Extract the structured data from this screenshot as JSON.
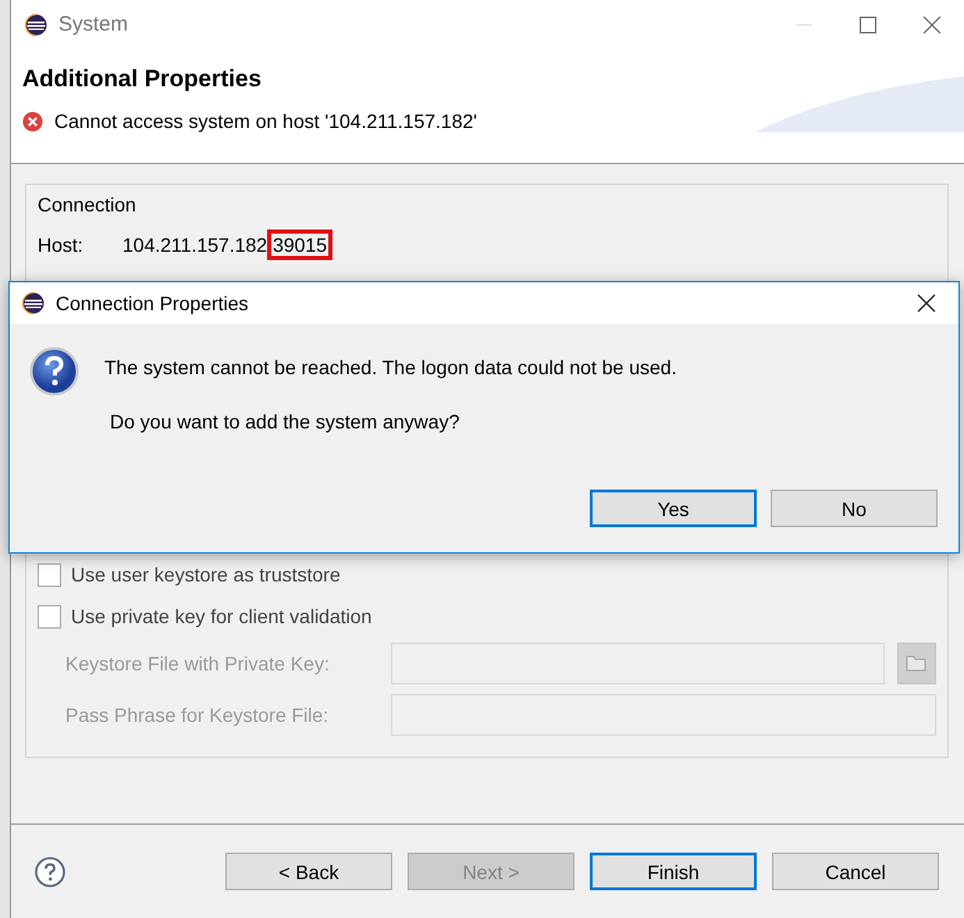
{
  "window": {
    "title": "System"
  },
  "header": {
    "title": "Additional Properties",
    "error": "Cannot access system on host '104.211.157.182'"
  },
  "group": {
    "title": "Connection",
    "host_label": "Host:",
    "host": "104.211.157.182",
    "port": "39015",
    "port_highlighted": true
  },
  "options": [
    {
      "kind": "checkbox",
      "label": "Use user keystore as truststore",
      "checked": false
    },
    {
      "kind": "checkbox",
      "label": "Use private key for client validation",
      "checked": false
    },
    {
      "kind": "field",
      "label": "Keystore File with Private Key:",
      "disabled": true,
      "browse": true
    },
    {
      "kind": "field",
      "label": "Pass Phrase for Keystore File:",
      "disabled": true,
      "browse": false
    }
  ],
  "buttons": [
    {
      "label": "< Back",
      "disabled": false,
      "default": false
    },
    {
      "label": "Next >",
      "disabled": true,
      "default": false
    },
    {
      "label": "Finish",
      "disabled": false,
      "default": true
    },
    {
      "label": "Cancel",
      "disabled": false,
      "default": false
    }
  ],
  "dialog": {
    "title": "Connection Properties",
    "message": "The system cannot be reached. The logon data could not be used.",
    "question": "Do you want to add the system anyway?",
    "buttons": [
      {
        "label": "Yes",
        "default": true
      },
      {
        "label": "No",
        "default": false
      }
    ]
  }
}
